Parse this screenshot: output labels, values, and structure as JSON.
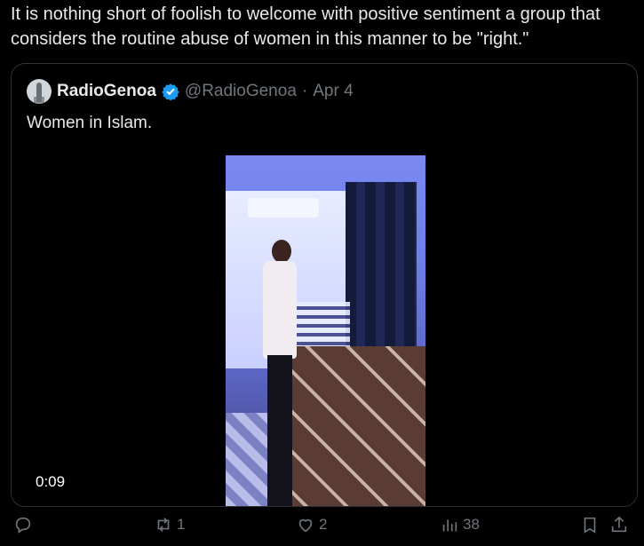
{
  "post": {
    "text": "It is nothing short of foolish to welcome with positive sentiment a group that considers the routine abuse of women in this manner to be \"right.\""
  },
  "quote": {
    "author_name": "RadioGenoa",
    "handle": "@RadioGenoa",
    "separator": "·",
    "date": "Apr 4",
    "text": "Women in Islam.",
    "video_timestamp": "0:09"
  },
  "actions": {
    "reply_icon": "reply-icon",
    "retweet_count": "1",
    "like_count": "2",
    "views_count": "38",
    "bookmark_icon": "bookmark-icon",
    "share_icon": "share-icon"
  },
  "colors": {
    "background": "#000000",
    "text_primary": "#e7e9ea",
    "text_secondary": "#71767b",
    "verified_blue": "#1d9bf0",
    "border": "#2f3336"
  }
}
